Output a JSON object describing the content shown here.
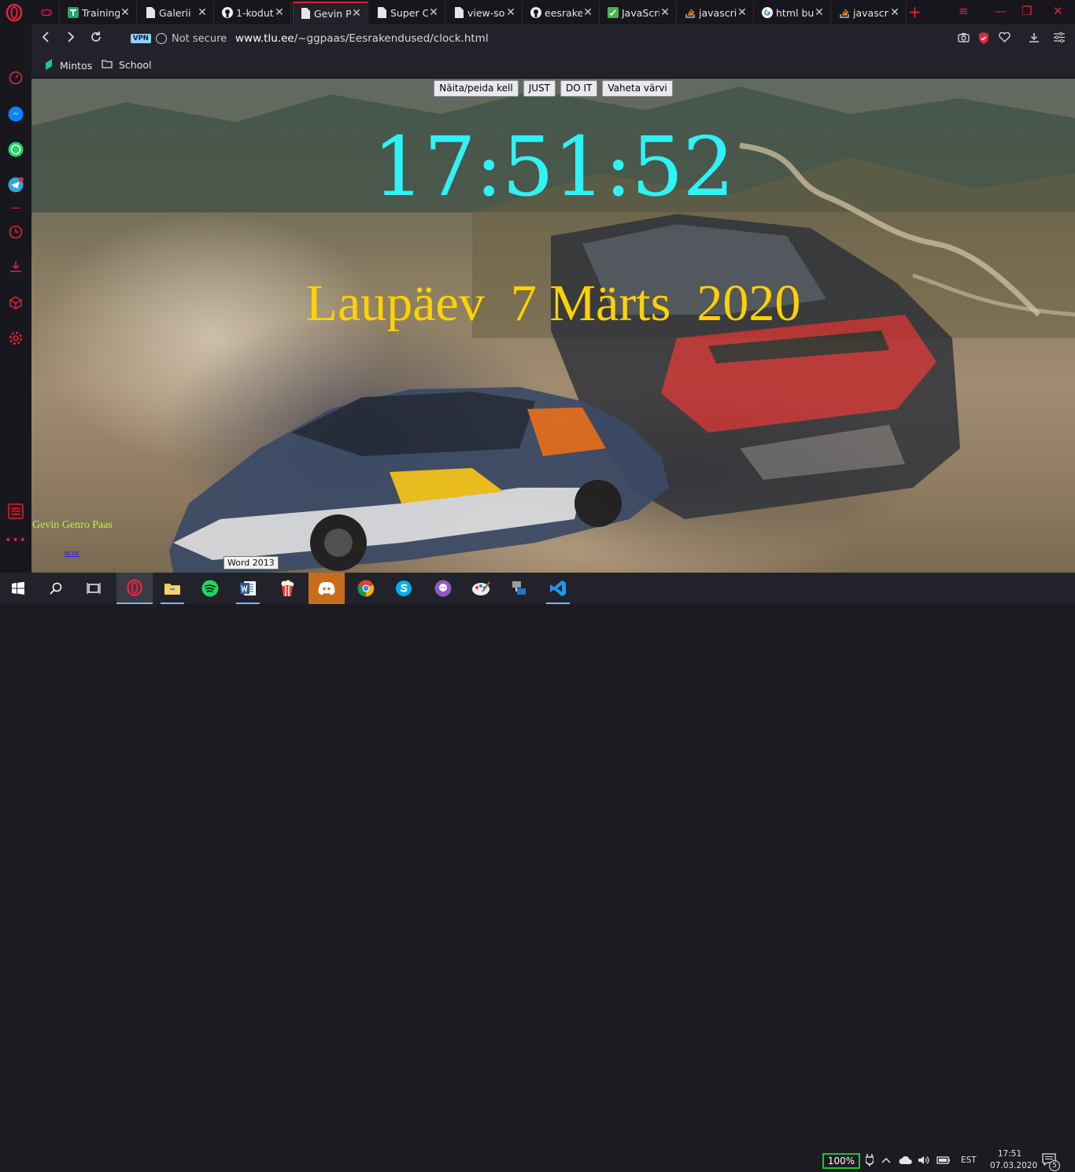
{
  "browser": {
    "tabs": [
      {
        "label": "",
        "icon": "gamepad-icon"
      },
      {
        "label": "Training",
        "icon": "sheets-icon"
      },
      {
        "label": "Galerii",
        "icon": "page-icon"
      },
      {
        "label": "1-kodut",
        "icon": "github-icon"
      },
      {
        "label": "Gevin Pa",
        "icon": "page-icon",
        "active": true
      },
      {
        "label": "Super C",
        "icon": "page-icon"
      },
      {
        "label": "view-so",
        "icon": "page-icon"
      },
      {
        "label": "eesraken",
        "icon": "github-icon"
      },
      {
        "label": "JavaScri",
        "icon": "js-icon"
      },
      {
        "label": "javascrip",
        "icon": "stackoverflow-icon"
      },
      {
        "label": "html bu",
        "icon": "google-icon"
      },
      {
        "label": "javascrip",
        "icon": "stackoverflow-icon"
      }
    ],
    "address": {
      "vpn": "VPN",
      "security": "Not secure",
      "url_host": "www.tlu.ee",
      "url_path": "/~ggpaas/Eesrakendused/clock.html"
    },
    "bookmarks": [
      {
        "label": "Mintos",
        "icon": "mintos-icon"
      },
      {
        "label": "School",
        "icon": "folder-icon"
      }
    ]
  },
  "page": {
    "buttons": [
      "Näita/peida kell",
      "JUST",
      "DO IT",
      "Vaheta värvi"
    ],
    "clock": "17:51:52",
    "date": "Laupäev  7 Märts  2020",
    "author": "Gevin Genro Paas",
    "link": "scpc"
  },
  "taskbar": {
    "tooltip": "Word 2013",
    "battery": "100%",
    "language": "EST",
    "time": "17:51",
    "date": "07.03.2020",
    "notifications": "5"
  },
  "colors": {
    "clock": "#2ef3f6",
    "date": "#ffd200",
    "author": "#adff2f",
    "opera_red": "#e0253d"
  }
}
